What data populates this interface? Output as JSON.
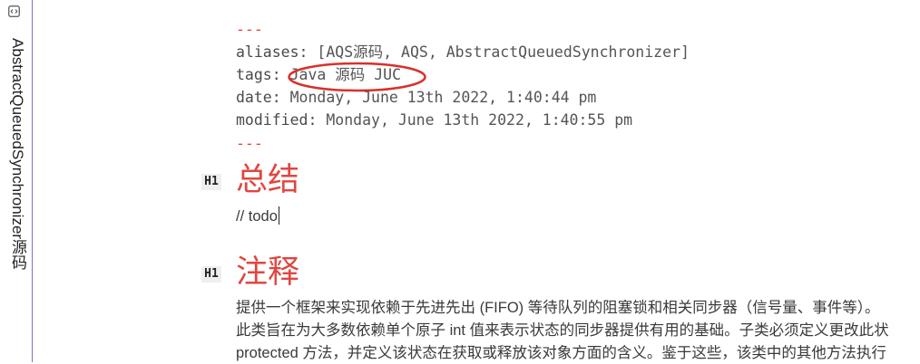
{
  "sidebar": {
    "tab_title": "AbstractQueuedSynchronizer源码",
    "tab_icon": "code-file-icon"
  },
  "frontmatter": {
    "open_delim": "---",
    "aliases_key": "aliases:",
    "aliases_value": "[AQS源码, AQS, AbstractQueuedSynchronizer]",
    "tags_key": "tags:",
    "tags_value": "Java 源码 JUC",
    "date_key": "date:",
    "date_value": "Monday, June 13th 2022, 1:40:44 pm",
    "modified_key": "modified:",
    "modified_value": "Monday, June 13th 2022, 1:40:55 pm",
    "close_delim": "---",
    "highlight_color": "#d9302a"
  },
  "sections": [
    {
      "badge": "H1",
      "title": "总结",
      "lines": [
        "// todo"
      ]
    },
    {
      "badge": "H1",
      "title": "注释",
      "lines": [
        "提供一个框架来实现依赖于先进先出 (FIFO) 等待队列的阻塞锁和相关同步器（信号量、事件等）。",
        "此类旨在为大多数依赖单个原子 int 值来表示状态的同步器提供有用的基础。子类必须定义更改此状",
        "protected 方法，并定义该状态在获取或释放该对象方面的含义。鉴于这些，该类中的其他方法执行"
      ]
    }
  ],
  "colors": {
    "heading": "#e0463f",
    "tab_border": "#7b72c8"
  }
}
